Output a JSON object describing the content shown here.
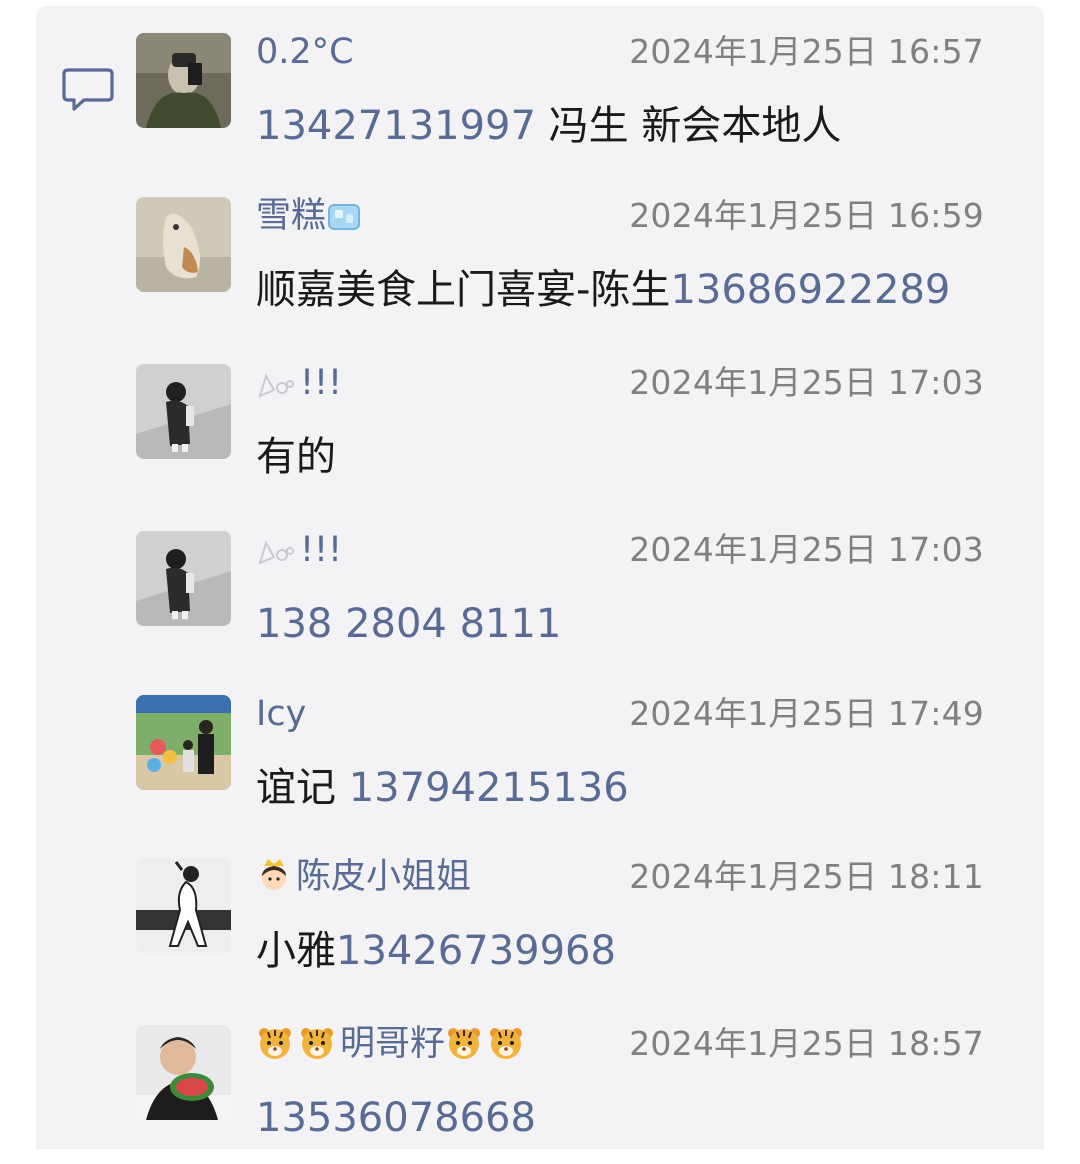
{
  "comments": [
    {
      "name": "0.2°C",
      "time": "2024年1月25日 16:57",
      "phone": "13427131997",
      "suffix": " 冯生 新会本地人",
      "prefix": ""
    },
    {
      "name": "雪糕",
      "time": "2024年1月25日 16:59",
      "prefix": "顺嘉美食上门喜宴-陈生",
      "phone": "13686922289",
      "suffix": ""
    },
    {
      "name": "!!!",
      "time": "2024年1月25日 17:03",
      "prefix": "有的",
      "phone": "",
      "suffix": ""
    },
    {
      "name": "!!!",
      "time": "2024年1月25日 17:03",
      "prefix": "",
      "phone": "138 2804 8111",
      "suffix": ""
    },
    {
      "name": "Icy",
      "time": "2024年1月25日 17:49",
      "prefix": "谊记 ",
      "phone": "13794215136",
      "suffix": ""
    },
    {
      "name": "陈皮小姐姐",
      "time": "2024年1月25日 18:11",
      "prefix": "小雅",
      "phone": "13426739968",
      "suffix": ""
    },
    {
      "name": "明哥籽",
      "time": "2024年1月25日 18:57",
      "prefix": "",
      "phone": "13536078668",
      "suffix": ""
    }
  ],
  "icons": {
    "comment": "comment-bubble-icon",
    "ice": "ice-cube-icon",
    "tiger": "tiger-face-icon",
    "princess": "princess-icon",
    "flower": "decorative-flower-icon"
  },
  "colors": {
    "link": "#586b95",
    "time": "#808080",
    "panel": "#f3f3f5"
  }
}
